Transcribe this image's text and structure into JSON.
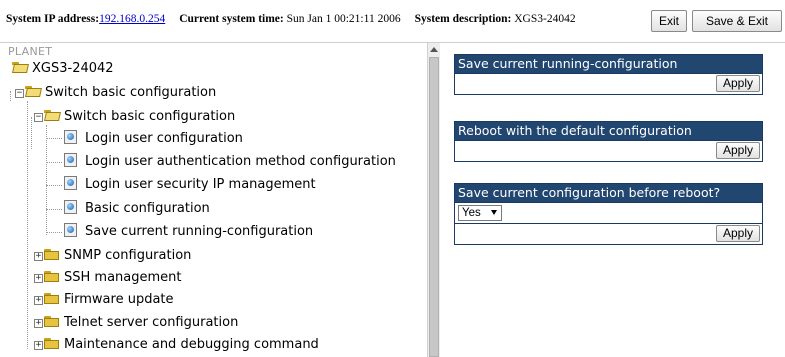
{
  "header": {
    "ip_label": "System IP address:",
    "ip_value": "192.168.0.254",
    "time_label": "Current system time:",
    "time_value": "Sun Jan 1 00:21:11 2006",
    "desc_label": "System description:",
    "desc_value": "XGS3-24042",
    "exit_label": "Exit",
    "save_exit_label": "Save & Exit"
  },
  "tree": {
    "root": "PLANET",
    "device": "XGS3-24042",
    "group": "Switch basic configuration",
    "subgroup": "Switch basic configuration",
    "pages": [
      "Login user configuration",
      "Login user authentication method configuration",
      "Login user security IP management",
      "Basic configuration",
      "Save current running-configuration"
    ],
    "folders": [
      "SNMP configuration",
      "SSH management",
      "Firmware update",
      "Telnet server configuration",
      "Maintenance and debugging command"
    ]
  },
  "panels": {
    "save": {
      "title": "Save current running-configuration",
      "apply": "Apply"
    },
    "reboot": {
      "title": "Reboot with the default configuration",
      "apply": "Apply"
    },
    "save_before_reboot": {
      "title": "Save current configuration before reboot?",
      "selected": "Yes",
      "apply": "Apply"
    }
  },
  "colors": {
    "panel_header": "#21466f",
    "link": "#0000cc",
    "folder": "#e6c440"
  },
  "icons": {
    "folder": "folder-icon",
    "page": "page-icon",
    "expand": "expand-toggle-icon"
  }
}
